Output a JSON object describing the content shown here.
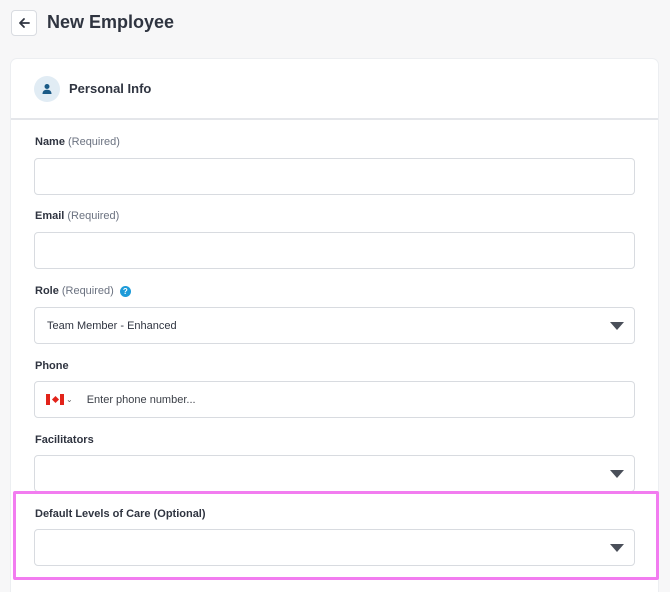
{
  "header": {
    "title": "New Employee"
  },
  "section": {
    "title": "Personal Info"
  },
  "fields": {
    "name": {
      "label": "Name",
      "qualifier": "(Required)",
      "value": ""
    },
    "email": {
      "label": "Email",
      "qualifier": "(Required)",
      "value": ""
    },
    "role": {
      "label": "Role",
      "qualifier": "(Required)",
      "help": "?",
      "value": "Team Member - Enhanced"
    },
    "phone": {
      "label": "Phone",
      "placeholder": "Enter phone number...",
      "country_chevron": "⌄"
    },
    "facilitators": {
      "label": "Facilitators",
      "value": ""
    },
    "levels_of_care": {
      "label": "Default Levels of Care (Optional)",
      "value": ""
    }
  },
  "colors": {
    "highlight": "#f27cf0",
    "help_icon": "#1d9bd9",
    "avatar_bg": "#e1ecf4"
  }
}
